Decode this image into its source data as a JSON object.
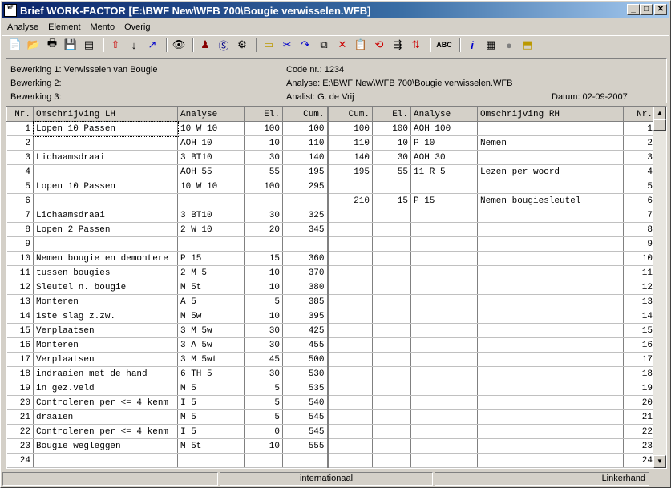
{
  "window": {
    "title": "Brief WORK-FACTOR   [E:\\BWF New\\WFB 700\\Bougie verwisselen.WFB]",
    "icon_label": "WORK FACTOR"
  },
  "menu": [
    "Analyse",
    "Element",
    "Mento",
    "Overig"
  ],
  "toolbar_icons": [
    "new-file-icon",
    "open-folder-icon",
    "print-icon",
    "save-icon",
    "document-icon",
    "insert-above-icon",
    "arrow-down-icon",
    "arrow-diagonal-icon",
    "view-eye-icon",
    "person-icon",
    "s-circle-icon",
    "gear-icon",
    "folder-icon",
    "cut-row-icon",
    "redo-icon",
    "copy-icon",
    "delete-icon",
    "paste-icon",
    "replace-icon",
    "merge-icon",
    "split-icon",
    "spellcheck-icon",
    "info-icon",
    "calculator-icon",
    "record-dot-icon",
    "export-icon"
  ],
  "toolbar_abc": "ABC",
  "info": {
    "bewerking1": "Bewerking 1: Verwisselen van Bougie",
    "bewerking2": "Bewerking 2:",
    "bewerking3": "Bewerking 3:",
    "code": "Code nr.: 1234",
    "analyse": "Analyse: E:\\BWF New\\WFB 700\\Bougie verwisselen.WFB",
    "analist": "Analist: G. de Vrij",
    "datum": "Datum: 02-09-2007"
  },
  "columns": {
    "nr": "Nr.",
    "omschr_lh": "Omschrijving  LH",
    "analyse_lh": "Analyse",
    "el_lh": "El.",
    "cum_lh": "Cum.",
    "cum_rh": "Cum.",
    "el_rh": "El.",
    "analyse_rh": "Analyse",
    "omschr_rh": "Omschrijving  RH",
    "nr_rh": "Nr."
  },
  "rows": [
    {
      "nr": "1",
      "lh": "Lopen 10 Passen",
      "alh": "10 W 10",
      "ellh": "100",
      "cumlh": "100",
      "cumrh": "100",
      "elrh": "100",
      "arh": "AOH 100",
      "rh": ""
    },
    {
      "nr": "2",
      "lh": "",
      "alh": "AOH 10",
      "ellh": "10",
      "cumlh": "110",
      "cumrh": "110",
      "elrh": "10",
      "arh": "P 10",
      "rh": "Nemen"
    },
    {
      "nr": "3",
      "lh": "Lichaamsdraai",
      "alh": "3 BT10",
      "ellh": "30",
      "cumlh": "140",
      "cumrh": "140",
      "elrh": "30",
      "arh": "AOH 30",
      "rh": ""
    },
    {
      "nr": "4",
      "lh": "",
      "alh": "AOH 55",
      "ellh": "55",
      "cumlh": "195",
      "cumrh": "195",
      "elrh": "55",
      "arh": "11 R  5",
      "rh": "Lezen per woord"
    },
    {
      "nr": "5",
      "lh": "Lopen 10 Passen",
      "alh": "10 W 10",
      "ellh": "100",
      "cumlh": "295",
      "cumrh": "",
      "elrh": "",
      "arh": "",
      "rh": ""
    },
    {
      "nr": "6",
      "lh": "",
      "alh": "",
      "ellh": "",
      "cumlh": "",
      "cumrh": "210",
      "elrh": "15",
      "arh": "P 15",
      "rh": "Nemen bougiesleutel"
    },
    {
      "nr": "7",
      "lh": "Lichaamsdraai",
      "alh": "3 BT10",
      "ellh": "30",
      "cumlh": "325",
      "cumrh": "",
      "elrh": "",
      "arh": "",
      "rh": ""
    },
    {
      "nr": "8",
      "lh": "Lopen 2 Passen",
      "alh": "2 W 10",
      "ellh": "20",
      "cumlh": "345",
      "cumrh": "",
      "elrh": "",
      "arh": "",
      "rh": ""
    },
    {
      "nr": "9",
      "lh": "",
      "alh": "",
      "ellh": "",
      "cumlh": "",
      "cumrh": "",
      "elrh": "",
      "arh": "",
      "rh": ""
    },
    {
      "nr": "10",
      "lh": "Nemen bougie en demontere",
      "alh": "P 15",
      "ellh": "15",
      "cumlh": "360",
      "cumrh": "",
      "elrh": "",
      "arh": "",
      "rh": ""
    },
    {
      "nr": "11",
      "lh": "tussen bougies",
      "alh": "2 M  5",
      "ellh": "10",
      "cumlh": "370",
      "cumrh": "",
      "elrh": "",
      "arh": "",
      "rh": ""
    },
    {
      "nr": "12",
      "lh": "Sleutel n. bougie",
      "alh": "M  5t",
      "ellh": "10",
      "cumlh": "380",
      "cumrh": "",
      "elrh": "",
      "arh": "",
      "rh": ""
    },
    {
      "nr": "13",
      "lh": "Monteren",
      "alh": "A  5",
      "ellh": "5",
      "cumlh": "385",
      "cumrh": "",
      "elrh": "",
      "arh": "",
      "rh": ""
    },
    {
      "nr": "14",
      "lh": "1ste slag z.zw.",
      "alh": "M  5w",
      "ellh": "10",
      "cumlh": "395",
      "cumrh": "",
      "elrh": "",
      "arh": "",
      "rh": ""
    },
    {
      "nr": "15",
      "lh": "Verplaatsen",
      "alh": "3 M  5w",
      "ellh": "30",
      "cumlh": "425",
      "cumrh": "",
      "elrh": "",
      "arh": "",
      "rh": ""
    },
    {
      "nr": "16",
      "lh": "Monteren",
      "alh": "3 A  5w",
      "ellh": "30",
      "cumlh": "455",
      "cumrh": "",
      "elrh": "",
      "arh": "",
      "rh": ""
    },
    {
      "nr": "17",
      "lh": "Verplaatsen",
      "alh": "3 M  5wt",
      "ellh": "45",
      "cumlh": "500",
      "cumrh": "",
      "elrh": "",
      "arh": "",
      "rh": ""
    },
    {
      "nr": "18",
      "lh": "indraaien met de hand",
      "alh": "6 TH 5",
      "ellh": "30",
      "cumlh": "530",
      "cumrh": "",
      "elrh": "",
      "arh": "",
      "rh": ""
    },
    {
      "nr": "19",
      "lh": "in gez.veld",
      "alh": "M  5",
      "ellh": "5",
      "cumlh": "535",
      "cumrh": "",
      "elrh": "",
      "arh": "",
      "rh": ""
    },
    {
      "nr": "20",
      "lh": "Controleren per <= 4 kenm",
      "alh": "I  5",
      "ellh": "5",
      "cumlh": "540",
      "cumrh": "",
      "elrh": "",
      "arh": "",
      "rh": ""
    },
    {
      "nr": "21",
      "lh": "draaien",
      "alh": "M  5",
      "ellh": "5",
      "cumlh": "545",
      "cumrh": "",
      "elrh": "",
      "arh": "",
      "rh": ""
    },
    {
      "nr": "22",
      "lh": "Controleren per <= 4 kenm",
      "alh": "I  5",
      "ellh": "0",
      "cumlh": "545",
      "cumrh": "",
      "elrh": "",
      "arh": "",
      "rh": ""
    },
    {
      "nr": "23",
      "lh": "Bougie wegleggen",
      "alh": "M  5t",
      "ellh": "10",
      "cumlh": "555",
      "cumrh": "",
      "elrh": "",
      "arh": "",
      "rh": ""
    },
    {
      "nr": "24",
      "lh": "",
      "alh": "",
      "ellh": "",
      "cumlh": "",
      "cumrh": "",
      "elrh": "",
      "arh": "",
      "rh": ""
    }
  ],
  "status": {
    "panel1": "",
    "panel2": "internationaal",
    "panel3": "Linkerhand"
  }
}
